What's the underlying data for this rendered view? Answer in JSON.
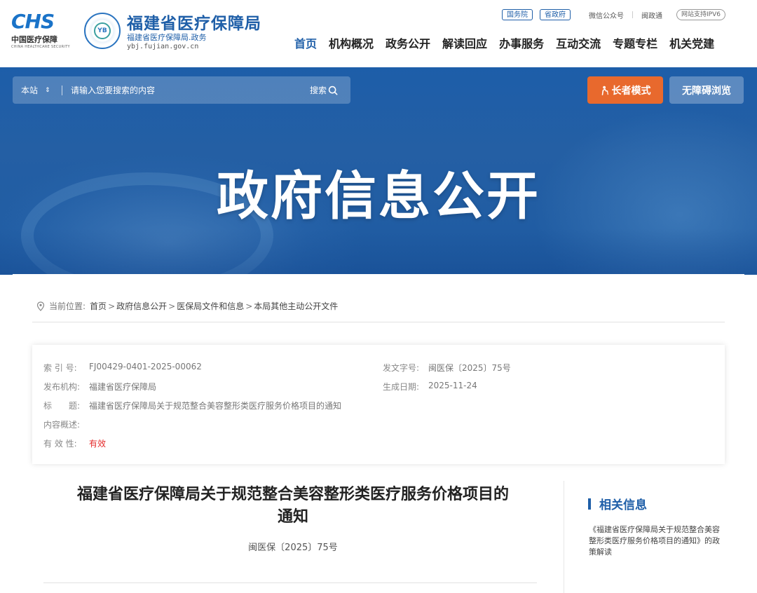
{
  "header": {
    "chs_mark": "CHS",
    "chs_cn": "中国医疗保障",
    "chs_en": "CHINA HEALTHCARE SECURITY",
    "seal_text": "YB",
    "org_name": "福建省医疗保障局",
    "org_sub": "福建省医疗保障局.政务",
    "org_url": "ybj.fujian.gov.cn",
    "pills": [
      "国务院",
      "省政府"
    ],
    "links": [
      "微信公众号",
      "闽政通"
    ],
    "ipv6": "网站支持IPV6",
    "nav": [
      "首页",
      "机构概况",
      "政务公开",
      "解读回应",
      "办事服务",
      "互动交流",
      "专题专栏",
      "机关党建"
    ]
  },
  "banner": {
    "scope": "本站",
    "search_placeholder": "请输入您要搜索的内容",
    "search_label": "搜索",
    "elder_label": "长者模式",
    "access_label": "无障碍浏览",
    "title": "政府信息公开"
  },
  "breadcrumb": {
    "label": "当前位置:",
    "items": [
      "首页",
      "政府信息公开",
      "医保局文件和信息",
      "本局其他主动公开文件"
    ]
  },
  "meta": {
    "index_label": "索 引 号:",
    "index_value": "FJ00429-0401-2025-00062",
    "docno_label": "发文字号:",
    "docno_value": "闽医保〔2025〕75号",
    "org_label": "发布机构:",
    "org_value": "福建省医疗保障局",
    "date_label": "生成日期:",
    "date_value": "2025-11-24",
    "title_label": "标　　题:",
    "title_value": "福建省医疗保障局关于规范整合美容整形类医疗服务价格项目的通知",
    "summary_label": "内容概述:",
    "summary_value": "",
    "valid_label": "有 效 性:",
    "valid_value": "有效"
  },
  "doc": {
    "title_line1": "福建省医疗保障局关于规范整合美容整形类医疗服务价格项目的",
    "title_line2": "通知",
    "number": "闽医保〔2025〕75号"
  },
  "sidebar": {
    "title": "相关信息",
    "link": "《福建省医疗保障局关于规范整合美容整形类医疗服务价格项目的通知》的政策解读"
  }
}
